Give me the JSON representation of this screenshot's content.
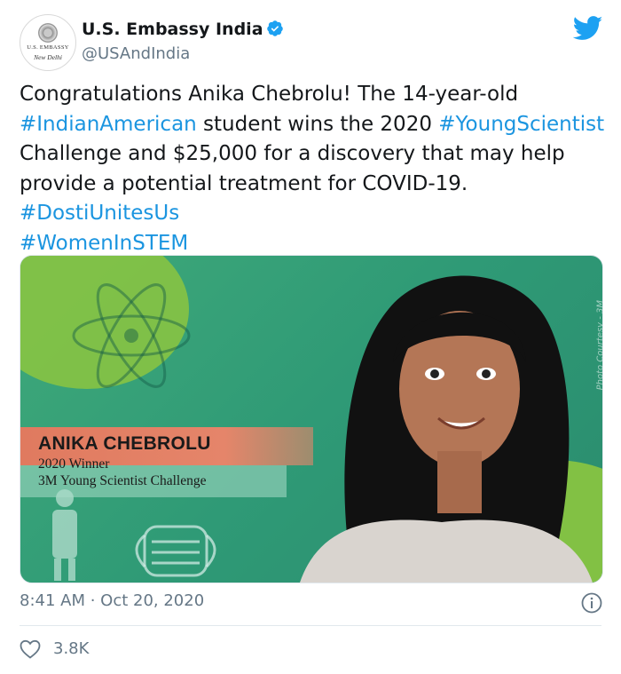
{
  "account": {
    "name": "U.S. Embassy India",
    "handle": "@USAndIndia",
    "avatar_line1": "U.S. EMBASSY",
    "avatar_line2": "New Delhi",
    "verified": true
  },
  "tweet": {
    "segments": [
      {
        "text": "Congratulations Anika Chebrolu! The 14-year-old ",
        "type": "text"
      },
      {
        "text": "#IndianAmerican",
        "type": "hashtag"
      },
      {
        "text": " student wins the 2020 ",
        "type": "text"
      },
      {
        "text": "#YoungScientist",
        "type": "hashtag"
      },
      {
        "text": " Challenge and $25,000 for a discovery that may help provide a potential treatment for COVID-19. ",
        "type": "text"
      },
      {
        "text": "#DostiUnitesUs",
        "type": "hashtag"
      },
      {
        "text": " ",
        "type": "text"
      },
      {
        "text": "#WomenInSTEM",
        "type": "hashtag"
      }
    ]
  },
  "media": {
    "banner_name": "ANIKA CHEBROLU",
    "banner_line1": "2020 Winner",
    "banner_line2": "3M Young Scientist Challenge",
    "courtesy": "Photo Courtesy - 3M"
  },
  "meta": {
    "timestamp": "8:41 AM · Oct 20, 2020"
  },
  "engagement": {
    "likes": "3.8K"
  },
  "colors": {
    "link": "#1b95e0",
    "twitter_blue": "#1da1f2",
    "secondary_text": "#657786"
  }
}
